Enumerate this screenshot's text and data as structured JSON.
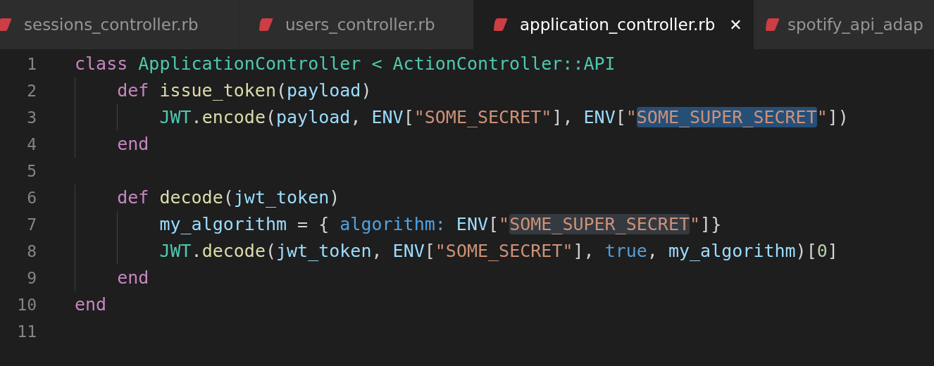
{
  "tabs": [
    {
      "label": "sessions_controller.rb",
      "selected": false
    },
    {
      "label": "users_controller.rb",
      "selected": false
    },
    {
      "label": "application_controller.rb",
      "selected": true,
      "close": "✕"
    },
    {
      "label": "spotify_api_adap",
      "selected": false
    }
  ],
  "editor": {
    "lines": [
      {
        "number": "1",
        "tokens": [
          {
            "text": "class",
            "kind": "keyword"
          },
          {
            "text": " ApplicationController < ActionController::API",
            "kind": "class"
          }
        ]
      },
      {
        "number": "2",
        "tokens": [
          {
            "text": "    def",
            "kind": "keyword"
          },
          {
            "text": " issue_token",
            "kind": "function"
          },
          {
            "text": "(",
            "kind": "plain"
          },
          {
            "text": "payload",
            "kind": "variable"
          },
          {
            "text": ")",
            "kind": "plain"
          }
        ]
      },
      {
        "number": "3",
        "tokens": [
          {
            "text": "        JWT",
            "kind": "class"
          },
          {
            "text": ".",
            "kind": "plain"
          },
          {
            "text": "encode",
            "kind": "function"
          },
          {
            "text": "(",
            "kind": "plain"
          },
          {
            "text": "payload",
            "kind": "variable"
          },
          {
            "text": ", ",
            "kind": "plain"
          },
          {
            "text": "ENV",
            "kind": "constant"
          },
          {
            "text": "[",
            "kind": "plain"
          },
          {
            "text": "\"SOME_SECRET\"",
            "kind": "string"
          },
          {
            "text": "], ",
            "kind": "plain"
          },
          {
            "text": "ENV",
            "kind": "constant"
          },
          {
            "text": "[",
            "kind": "plain"
          },
          {
            "text": "\"",
            "kind": "string"
          },
          {
            "text": "SOME_SUPER_SECRET",
            "kind": "string-selected"
          },
          {
            "text": "\"",
            "kind": "string"
          },
          {
            "text": "])",
            "kind": "plain"
          }
        ]
      },
      {
        "number": "4",
        "tokens": [
          {
            "text": "    end",
            "kind": "keyword"
          }
        ]
      },
      {
        "number": "5"
      },
      {
        "number": "6",
        "tokens": [
          {
            "text": "    def",
            "kind": "keyword"
          },
          {
            "text": " decode",
            "kind": "function"
          },
          {
            "text": "(",
            "kind": "plain"
          },
          {
            "text": "jwt_token",
            "kind": "variable"
          },
          {
            "text": ")",
            "kind": "plain"
          }
        ]
      },
      {
        "number": "7",
        "tokens": [
          {
            "text": "        my_algorithm",
            "kind": "variable"
          },
          {
            "text": " = { ",
            "kind": "plain"
          },
          {
            "text": "algorithm:",
            "kind": "symbol"
          },
          {
            "text": " ENV",
            "kind": "constant"
          },
          {
            "text": "[",
            "kind": "plain"
          },
          {
            "text": "\"",
            "kind": "string"
          },
          {
            "text": "SOME_SUPER_SECRET",
            "kind": "string-match"
          },
          {
            "text": "\"",
            "kind": "string"
          },
          {
            "text": "]}",
            "kind": "plain"
          }
        ]
      },
      {
        "number": "8",
        "tokens": [
          {
            "text": "        JWT",
            "kind": "class"
          },
          {
            "text": ".",
            "kind": "plain"
          },
          {
            "text": "decode",
            "kind": "function"
          },
          {
            "text": "(",
            "kind": "plain"
          },
          {
            "text": "jwt_token",
            "kind": "variable"
          },
          {
            "text": ", ",
            "kind": "plain"
          },
          {
            "text": "ENV",
            "kind": "constant"
          },
          {
            "text": "[",
            "kind": "plain"
          },
          {
            "text": "\"SOME_SECRET\"",
            "kind": "string"
          },
          {
            "text": "], ",
            "kind": "plain"
          },
          {
            "text": "true",
            "kind": "boolean"
          },
          {
            "text": ", ",
            "kind": "plain"
          },
          {
            "text": "my_algorithm",
            "kind": "variable"
          },
          {
            "text": ")[",
            "kind": "plain"
          },
          {
            "text": "0",
            "kind": "number"
          },
          {
            "text": "]",
            "kind": "plain"
          }
        ]
      },
      {
        "number": "9",
        "tokens": [
          {
            "text": "    end",
            "kind": "keyword"
          }
        ]
      },
      {
        "number": "10",
        "tokens": [
          {
            "text": "end",
            "kind": "keyword"
          }
        ]
      },
      {
        "number": "11"
      }
    ]
  }
}
